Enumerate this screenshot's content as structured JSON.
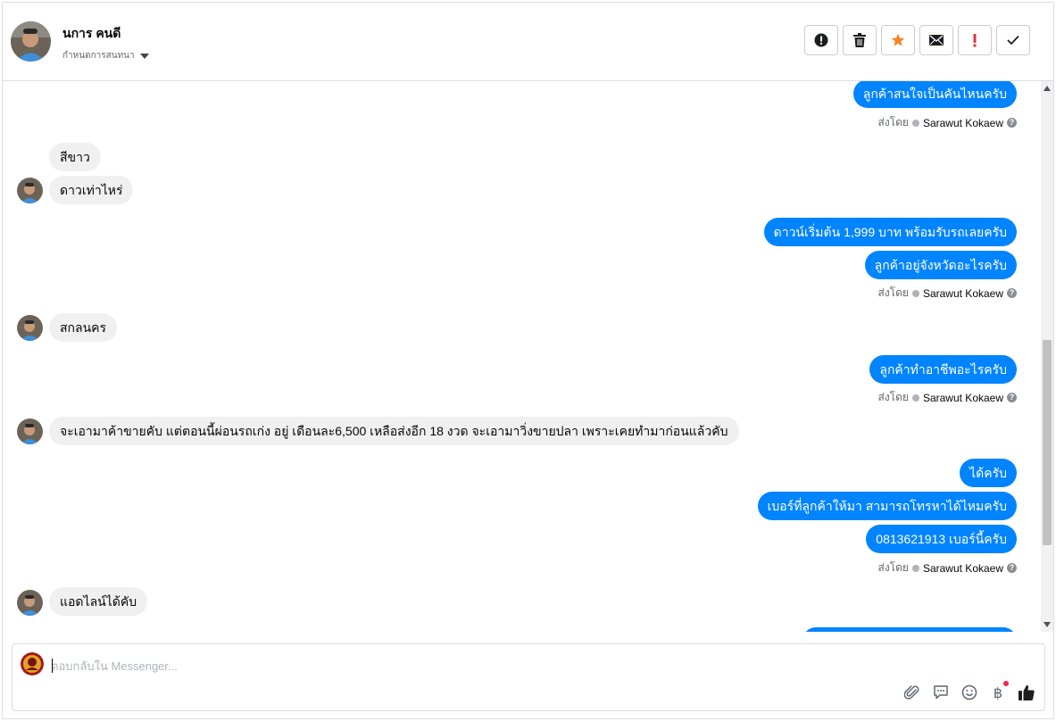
{
  "header": {
    "contact_name": "นการ คนดี",
    "conversation_label": "กำหนดการสนทนา",
    "actions": [
      {
        "name": "report-button",
        "icon": "alert-circle-icon"
      },
      {
        "name": "delete-button",
        "icon": "trash-icon"
      },
      {
        "name": "star-button",
        "icon": "star-icon",
        "color": "#f5832a"
      },
      {
        "name": "mail-button",
        "icon": "envelope-icon"
      },
      {
        "name": "important-button",
        "icon": "exclamation-icon",
        "color": "#e4333a"
      },
      {
        "name": "done-button",
        "icon": "check-icon"
      }
    ]
  },
  "messages": [
    {
      "dir": "out",
      "text": "ลูกค้าสนใจเป็นคันไหนครับ"
    },
    {
      "dir": "sentby",
      "label": "ส่งโดย",
      "who": "Sarawut Kokaew"
    },
    {
      "dir": "in",
      "text": "สีขาว"
    },
    {
      "dir": "in",
      "text": "ดาวเท่าไหร่"
    },
    {
      "dir": "out",
      "text": "ดาวน์เริ่มต้น 1,999 บาท พร้อมรับรถเลยครับ"
    },
    {
      "dir": "out",
      "text": "ลูกค้าอยู่จังหวัดอะไรครับ"
    },
    {
      "dir": "sentby",
      "label": "ส่งโดย",
      "who": "Sarawut Kokaew"
    },
    {
      "dir": "in",
      "text": "สกลนคร"
    },
    {
      "dir": "out",
      "text": "ลูกค้าทำอาชีพอะไรครับ"
    },
    {
      "dir": "sentby",
      "label": "ส่งโดย",
      "who": "Sarawut Kokaew"
    },
    {
      "dir": "in",
      "text": "จะเอามาค้าขายคับ แต่ตอนนี้ผ่อนรถเก่ง อยู่ เดือนละ6,500 เหลือส่งอีก 18 งวด จะเอามาวิ่งขายปลา เพราะเคยทำมาก่อนแล้วคับ"
    },
    {
      "dir": "out",
      "text": "ได้ครับ"
    },
    {
      "dir": "out",
      "text": "เบอร์ที่ลูกค้าให้มา สามารถโทรหาได้ไหมครับ"
    },
    {
      "dir": "out",
      "text": "0813621913 เบอร์นี้ครับ"
    },
    {
      "dir": "sentby",
      "label": "ส่งโดย",
      "who": "Sarawut Kokaew"
    },
    {
      "dir": "in",
      "text": "แอดไลน์ได้คับ"
    }
  ],
  "composer": {
    "placeholder": "ตอบกลับใน Messenger...",
    "value": "",
    "tools": [
      "paperclip-icon",
      "chat-bubble-icon",
      "smiley-icon",
      "baht-icon",
      "thumbs-up-icon"
    ],
    "baht_symbol": "฿"
  },
  "colors": {
    "accent": "#0084ff",
    "incoming_bg": "#f0f0f0",
    "border": "#dadde1"
  }
}
